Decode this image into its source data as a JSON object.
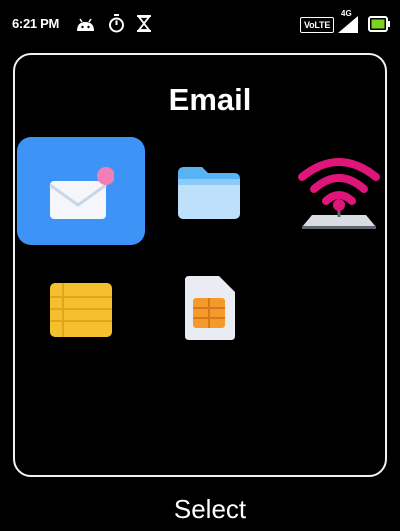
{
  "status_bar": {
    "time": "6:21 PM",
    "volte": "VoLTE",
    "network": "4G",
    "icons": [
      "android-debug-icon",
      "timer-icon",
      "hourglass-icon",
      "volte-icon",
      "signal-icon",
      "battery-icon"
    ]
  },
  "title": "Email",
  "apps": [
    {
      "icon": "email-app-icon",
      "selected": true
    },
    {
      "icon": "folder-icon",
      "selected": false
    },
    {
      "icon": "wifi-hotspot-icon",
      "selected": false
    },
    {
      "icon": "notes-icon",
      "selected": false
    },
    {
      "icon": "sim-card-icon",
      "selected": false
    }
  ],
  "softkey": {
    "center": "Select"
  },
  "colors": {
    "background": "#000000",
    "selection": "#3d93f6",
    "panel_border": "#f2f2f2",
    "battery": "#7ed321",
    "hotspot": "#e0157a",
    "folder": "#58b3f5",
    "notes": "#f4c02e",
    "sim": "#f39a2b"
  }
}
